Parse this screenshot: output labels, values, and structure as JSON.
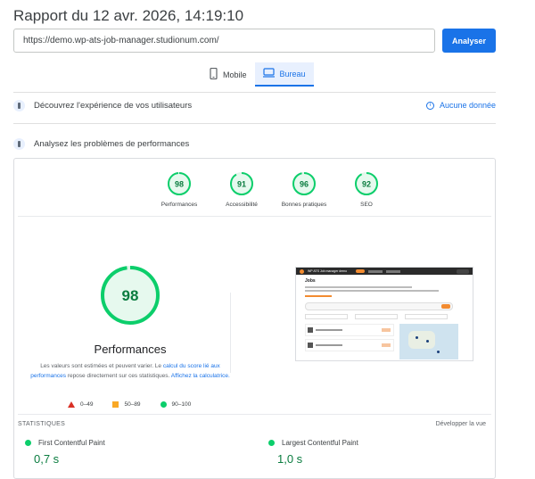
{
  "header": {
    "title": "Rapport du 12 avr. 2026, 14:19:10"
  },
  "search": {
    "url_value": "https://demo.wp-ats-job-manager.studionum.com/",
    "analyze_label": "Analyser"
  },
  "tabs": [
    {
      "label": "Mobile",
      "icon": "mobile-icon",
      "active": false
    },
    {
      "label": "Bureau",
      "icon": "desktop-icon",
      "active": true
    }
  ],
  "sections": {
    "user_experience": {
      "label": "Découvrez l'expérience de vos utilisateurs",
      "no_data": "Aucune donnée"
    },
    "performance": {
      "label": "Analysez les problèmes de performances"
    }
  },
  "scores": [
    {
      "label": "Performances",
      "value": 98
    },
    {
      "label": "Accessibilité",
      "value": 91
    },
    {
      "label": "Bonnes pratiques",
      "value": 96
    },
    {
      "label": "SEO",
      "value": 92
    }
  ],
  "performance_detail": {
    "value": 98,
    "title": "Performances",
    "note_part1": "Les valeurs sont estimées et peuvent varier. Le ",
    "note_link1": "calcul du score lié aux performances",
    "note_part2": " repose directement sur ces statistiques. ",
    "note_link2": "Affichez la calculatrice."
  },
  "legend": [
    {
      "shape": "triangle",
      "range": "0–49",
      "color": "#d93025"
    },
    {
      "shape": "square",
      "range": "50–89",
      "color": "#f9a825"
    },
    {
      "shape": "circle",
      "range": "90–100",
      "color": "#0cce6b"
    }
  ],
  "screenshot": {
    "site_name": "WP ATS Job manager demo",
    "page_title": "Jobs"
  },
  "stats": {
    "label": "STATISTIQUES",
    "expand_label": "Développer la vue",
    "metrics": [
      {
        "name": "First Contentful Paint",
        "value": "0,7 s"
      },
      {
        "name": "Largest Contentful Paint",
        "value": "1,0 s"
      }
    ]
  },
  "colors": {
    "accent": "#1a73e8",
    "good": "#0cce6b",
    "good_text": "#0a7c3f"
  }
}
